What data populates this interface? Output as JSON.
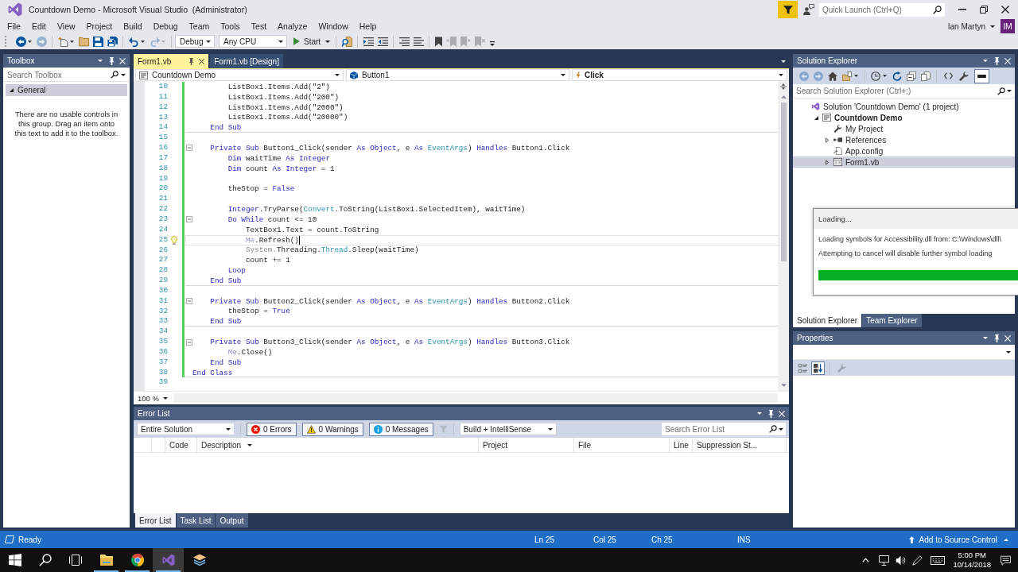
{
  "window": {
    "title": "Countdown Demo - Microsoft Visual Studio  (Administrator)",
    "quick_launch": {
      "placeholder": "Quick Launch (Ctrl+Q)"
    },
    "user": {
      "name": "Ian Martyn",
      "initials": "IM"
    }
  },
  "menu": [
    "File",
    "Edit",
    "View",
    "Project",
    "Build",
    "Debug",
    "Team",
    "Tools",
    "Test",
    "Analyze",
    "Window",
    "Help"
  ],
  "toolbar": [
    {
      "kind": "back",
      "disabled": false
    },
    {
      "kind": "caret",
      "disabled": false
    },
    {
      "kind": "forward",
      "disabled": true
    },
    {
      "kind": "separator"
    },
    {
      "kind": "new",
      "disabled": false
    },
    {
      "kind": "caret",
      "disabled": false
    },
    {
      "kind": "open",
      "disabled": false
    },
    {
      "kind": "save",
      "disabled": false
    },
    {
      "kind": "save_all",
      "disabled": false
    },
    {
      "kind": "separator"
    },
    {
      "kind": "undo",
      "disabled": false
    },
    {
      "kind": "caret",
      "disabled": false
    },
    {
      "kind": "redo",
      "disabled": true
    },
    {
      "kind": "caret",
      "disabled": true
    },
    {
      "kind": "separator"
    },
    {
      "kind": "combo",
      "value": "Debug"
    },
    {
      "kind": "combo",
      "value": "Any CPU"
    },
    {
      "kind": "start",
      "label": "Start"
    },
    {
      "kind": "separator"
    },
    {
      "kind": "find",
      "disabled": false
    },
    {
      "kind": "separator"
    },
    {
      "kind": "indent",
      "disabled": false
    },
    {
      "kind": "outdent",
      "disabled": false
    },
    {
      "kind": "separator"
    },
    {
      "kind": "comment",
      "disabled": false
    },
    {
      "kind": "uncomment",
      "disabled": false
    },
    {
      "kind": "separator"
    },
    {
      "kind": "bookmark",
      "disabled": false
    },
    {
      "kind": "bookmark_prev",
      "disabled": true
    },
    {
      "kind": "bookmark_next",
      "disabled": true
    },
    {
      "kind": "bookmark_clear",
      "disabled": true
    },
    {
      "kind": "overflow",
      "disabled": false
    }
  ],
  "toolbox": {
    "title": "Toolbox",
    "search": {
      "placeholder": "Search Toolbox"
    },
    "groups": [
      {
        "label": "General",
        "expanded": true,
        "empty_text": "There are no usable controls in this group. Drag an item onto this text to add it to the toolbox."
      }
    ]
  },
  "editor": {
    "tabs": [
      {
        "label": "Form1.vb",
        "selected": true
      },
      {
        "label": "Form1.vb [Design]",
        "selected": false
      }
    ],
    "navigation": [
      {
        "kind": "project",
        "value": "Countdown Demo"
      },
      {
        "kind": "object",
        "value": "Button1"
      },
      {
        "kind": "event",
        "value": "Click"
      }
    ],
    "lines": [
      {
        "number": "10",
        "kind": "plain",
        "changed": true,
        "current": false,
        "tokens": [
          {
            "kind": "plain",
            "text": "        ListBox1.Items.Add(\"2\")"
          }
        ]
      },
      {
        "number": "11",
        "kind": "plain",
        "changed": true,
        "current": false,
        "tokens": [
          {
            "kind": "plain",
            "text": "        ListBox1.Items.Add(\"200\")"
          }
        ]
      },
      {
        "number": "12",
        "kind": "plain",
        "changed": true,
        "current": false,
        "tokens": [
          {
            "kind": "plain",
            "text": "        ListBox1.Items.Add(\"2000\")"
          }
        ]
      },
      {
        "number": "13",
        "kind": "plain",
        "changed": true,
        "current": false,
        "tokens": [
          {
            "kind": "plain",
            "text": "        ListBox1.Items.Add(\"20000\")"
          }
        ]
      },
      {
        "number": "14",
        "kind": "end",
        "changed": true,
        "current": false,
        "tokens": [
          {
            "kind": "keyword",
            "text": "    End Sub"
          }
        ]
      },
      {
        "number": "15",
        "kind": "plain",
        "changed": true,
        "current": false
      },
      {
        "number": "16",
        "kind": "fold",
        "changed": true,
        "current": false,
        "tokens": [
          {
            "kind": "keyword",
            "text": "    Private Sub"
          },
          {
            "kind": "plain",
            "text": " Button1_Click(sender "
          },
          {
            "kind": "keyword",
            "text": "As Object"
          },
          {
            "kind": "plain",
            "text": ", e "
          },
          {
            "kind": "keyword",
            "text": "As"
          },
          {
            "kind": "type",
            "text": " EventArgs"
          },
          {
            "kind": "plain",
            "text": ") "
          },
          {
            "kind": "keyword",
            "text": "Handles"
          },
          {
            "kind": "plain",
            "text": " Button1.Click"
          }
        ]
      },
      {
        "number": "17",
        "kind": "plain",
        "changed": true,
        "current": false,
        "tokens": [
          {
            "kind": "keyword",
            "text": "        Dim"
          },
          {
            "kind": "plain",
            "text": " waitTime "
          },
          {
            "kind": "keyword",
            "text": "As Integer"
          }
        ]
      },
      {
        "number": "18",
        "kind": "plain",
        "changed": true,
        "current": false,
        "tokens": [
          {
            "kind": "keyword",
            "text": "        Dim"
          },
          {
            "kind": "plain",
            "text": " count "
          },
          {
            "kind": "keyword",
            "text": "As Integer"
          },
          {
            "kind": "plain",
            "text": " = 1"
          }
        ]
      },
      {
        "number": "19",
        "kind": "plain",
        "changed": true,
        "current": false
      },
      {
        "number": "20",
        "kind": "plain",
        "changed": true,
        "current": false,
        "tokens": [
          {
            "kind": "plain",
            "text": "        theStop = "
          },
          {
            "kind": "keyword",
            "text": "False"
          }
        ]
      },
      {
        "number": "21",
        "kind": "plain",
        "changed": true,
        "current": false
      },
      {
        "number": "22",
        "kind": "plain",
        "changed": true,
        "current": false,
        "tokens": [
          {
            "kind": "keyword",
            "text": "        Integer"
          },
          {
            "kind": "plain",
            "text": ".TryParse("
          },
          {
            "kind": "type",
            "text": "Convert"
          },
          {
            "kind": "plain",
            "text": ".ToString(ListBox1.SelectedItem), waitTime)"
          }
        ]
      },
      {
        "number": "23",
        "kind": "fold",
        "changed": true,
        "current": false,
        "tokens": [
          {
            "kind": "keyword",
            "text": "        Do While"
          },
          {
            "kind": "plain",
            "text": " count <= 10"
          }
        ]
      },
      {
        "number": "24",
        "kind": "plain",
        "changed": true,
        "current": false,
        "tokens": [
          {
            "kind": "plain",
            "text": "            TextBox1.Text = count.ToString"
          }
        ]
      },
      {
        "number": "25",
        "kind": "plain",
        "changed": true,
        "current": true,
        "tokens": [
          {
            "kind": "muted",
            "text": "            Me"
          },
          {
            "kind": "plain",
            "text": ".Refresh()"
          }
        ]
      },
      {
        "number": "26",
        "kind": "plain",
        "changed": true,
        "current": false,
        "tokens": [
          {
            "kind": "faded",
            "text": "            System."
          },
          {
            "kind": "plain",
            "text": "Threading."
          },
          {
            "kind": "type",
            "text": "Thread"
          },
          {
            "kind": "plain",
            "text": ".Sleep(waitTime)"
          }
        ]
      },
      {
        "number": "27",
        "kind": "plain",
        "changed": true,
        "current": false,
        "tokens": [
          {
            "kind": "plain",
            "text": "            count += 1"
          }
        ]
      },
      {
        "number": "28",
        "kind": "plain",
        "changed": true,
        "current": false,
        "tokens": [
          {
            "kind": "keyword",
            "text": "        Loop"
          }
        ]
      },
      {
        "number": "29",
        "kind": "end",
        "changed": true,
        "current": false,
        "tokens": [
          {
            "kind": "keyword",
            "text": "    End Sub"
          }
        ]
      },
      {
        "number": "30",
        "kind": "plain",
        "changed": true,
        "current": false
      },
      {
        "number": "31",
        "kind": "fold",
        "changed": true,
        "current": false,
        "tokens": [
          {
            "kind": "keyword",
            "text": "    Private Sub"
          },
          {
            "kind": "plain",
            "text": " Button2_Click(sender "
          },
          {
            "kind": "keyword",
            "text": "As Object"
          },
          {
            "kind": "plain",
            "text": ", e "
          },
          {
            "kind": "keyword",
            "text": "As"
          },
          {
            "kind": "type",
            "text": " EventArgs"
          },
          {
            "kind": "plain",
            "text": ") "
          },
          {
            "kind": "keyword",
            "text": "Handles"
          },
          {
            "kind": "plain",
            "text": " Button2.Click"
          }
        ]
      },
      {
        "number": "32",
        "kind": "plain",
        "changed": true,
        "current": false,
        "tokens": [
          {
            "kind": "plain",
            "text": "        theStop = "
          },
          {
            "kind": "keyword",
            "text": "True"
          }
        ]
      },
      {
        "number": "33",
        "kind": "end",
        "changed": true,
        "current": false,
        "tokens": [
          {
            "kind": "keyword",
            "text": "    End Sub"
          }
        ]
      },
      {
        "number": "34",
        "kind": "plain",
        "changed": true,
        "current": false
      },
      {
        "number": "35",
        "kind": "fold",
        "changed": true,
        "current": false,
        "tokens": [
          {
            "kind": "keyword",
            "text": "    Private Sub"
          },
          {
            "kind": "plain",
            "text": " Button3_Click(sender "
          },
          {
            "kind": "keyword",
            "text": "As Object"
          },
          {
            "kind": "plain",
            "text": ", e "
          },
          {
            "kind": "keyword",
            "text": "As"
          },
          {
            "kind": "type",
            "text": " EventArgs"
          },
          {
            "kind": "plain",
            "text": ") "
          },
          {
            "kind": "keyword",
            "text": "Handles"
          },
          {
            "kind": "plain",
            "text": " Button3.Click"
          }
        ]
      },
      {
        "number": "36",
        "kind": "plain",
        "changed": true,
        "current": false,
        "tokens": [
          {
            "kind": "muted",
            "text": "        Me"
          },
          {
            "kind": "plain",
            "text": ".Close()"
          }
        ]
      },
      {
        "number": "37",
        "kind": "plain",
        "changed": true,
        "current": false,
        "tokens": [
          {
            "kind": "keyword",
            "text": "    End Sub"
          }
        ]
      },
      {
        "number": "38",
        "kind": "end",
        "changed": true,
        "current": false,
        "tokens": [
          {
            "kind": "keyword",
            "text": "End Class"
          }
        ]
      },
      {
        "number": "39",
        "kind": "plain",
        "changed": false,
        "current": false
      }
    ],
    "zoom": "100 %"
  },
  "error_list": {
    "title": "Error List",
    "scope": "Entire Solution",
    "filters": [
      {
        "kind": "error",
        "label": "0 Errors",
        "on": true
      },
      {
        "kind": "warning",
        "label": "0 Warnings",
        "on": true
      },
      {
        "kind": "message",
        "label": "0 Messages",
        "on": true
      }
    ],
    "source": "Build + IntelliSense",
    "search": {
      "placeholder": "Search Error List"
    },
    "columns": [
      {
        "label": "Code",
        "sorted": false
      },
      {
        "label": "Description",
        "sorted": true
      },
      {
        "label": "Project",
        "sorted": false
      },
      {
        "label": "File",
        "sorted": false
      },
      {
        "label": "Line",
        "sorted": false
      },
      {
        "label": "Suppression St...",
        "sorted": false
      }
    ],
    "tabs": [
      {
        "label": "Error List",
        "selected": true
      },
      {
        "label": "Task List",
        "selected": false
      },
      {
        "label": "Output",
        "selected": false
      }
    ]
  },
  "solution_explorer": {
    "title": "Solution Explorer",
    "toolbar": [
      {
        "kind": "back",
        "disabled": true
      },
      {
        "kind": "forward",
        "disabled": true
      },
      {
        "kind": "home",
        "disabled": false
      },
      {
        "kind": "switch_views",
        "disabled": false
      },
      {
        "kind": "caret",
        "disabled": false
      },
      {
        "kind": "separator"
      },
      {
        "kind": "history",
        "disabled": false
      },
      {
        "kind": "caret",
        "disabled": false
      },
      {
        "kind": "refresh",
        "disabled": false
      },
      {
        "kind": "collapse",
        "disabled": false
      },
      {
        "kind": "copy",
        "disabled": false
      },
      {
        "kind": "separator"
      },
      {
        "kind": "code",
        "disabled": false
      },
      {
        "kind": "properties",
        "disabled": false
      },
      {
        "kind": "preview",
        "disabled": false,
        "on": true
      }
    ],
    "search": {
      "placeholder": "Search Solution Explorer (Ctrl+;)"
    },
    "tree": [
      {
        "kind": "solution",
        "label": "Solution 'Countdown Demo' (1 project)",
        "selected": false,
        "children": [
          {
            "kind": "project",
            "label": "Countdown Demo",
            "expanded": true,
            "selected": false,
            "children": [
              {
                "kind": "settings",
                "label": "My Project",
                "selected": false
              },
              {
                "kind": "references",
                "label": "References",
                "expanded": false,
                "selected": false
              },
              {
                "kind": "config",
                "label": "App.config",
                "selected": false
              },
              {
                "kind": "form",
                "label": "Form1.vb",
                "expanded": false,
                "selected": true
              }
            ]
          }
        ]
      }
    ],
    "tabs": [
      {
        "label": "Solution Explorer",
        "selected": true
      },
      {
        "label": "Team Explorer",
        "selected": false
      }
    ]
  },
  "loading": {
    "title": "Loading...",
    "message": "Loading symbols for Accessibility.dll from: C:\\Windows\\dll\\",
    "note": "Attempting to cancel will disable further symbol loading",
    "progress": {
      "level": 1
    }
  },
  "properties": {
    "title": "Properties",
    "toolbar": [
      {
        "kind": "categorized",
        "selected": false
      },
      {
        "kind": "alphabetical",
        "selected": true
      },
      {
        "kind": "separator"
      },
      {
        "kind": "property_pages",
        "disabled": true
      }
    ]
  },
  "status_bar": {
    "text": "Ready",
    "items": [
      "Ln 25",
      "Col 25",
      "Ch 25",
      "INS"
    ],
    "source_control": "Add to Source Control"
  },
  "taskbar": {
    "apps": [
      {
        "kind": "folder",
        "running": true,
        "selected": false
      },
      {
        "kind": "browser",
        "running": true,
        "selected": false
      },
      {
        "kind": "studio",
        "running": true,
        "selected": true
      },
      {
        "kind": "layers",
        "running": false,
        "selected": false
      }
    ],
    "time": "5:00 PM",
    "date": "10/14/2018"
  }
}
